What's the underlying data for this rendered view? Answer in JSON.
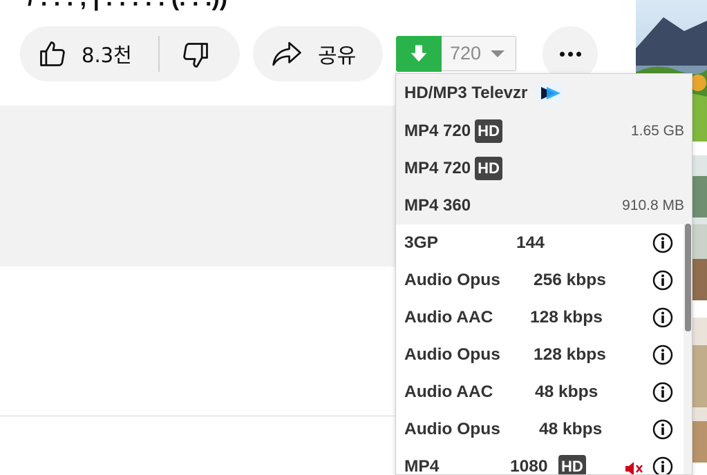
{
  "video": {
    "title_fragment": "/ . . . , | . . . . . (. . .))"
  },
  "actions": {
    "like_count": "8.3천",
    "share_label": "공유",
    "more_label": "..."
  },
  "downloader": {
    "selected_quality": "720",
    "menu": {
      "televzr": "HD/MP3 Televzr",
      "top_rows": [
        {
          "format": "MP4 720",
          "badge": "HD",
          "size": "1.65 GB"
        },
        {
          "format": "MP4 720",
          "badge": "HD",
          "size": ""
        },
        {
          "format": "MP4 360",
          "badge": "",
          "size": "910.8 MB"
        }
      ],
      "rows": [
        {
          "format": "3GP",
          "quality": "144"
        },
        {
          "format": "Audio Opus",
          "quality": "256 kbps"
        },
        {
          "format": "Audio AAC",
          "quality": "128 kbps"
        },
        {
          "format": "Audio Opus",
          "quality": "128 kbps"
        },
        {
          "format": "Audio AAC",
          "quality": "48 kbps"
        },
        {
          "format": "Audio Opus",
          "quality": "48 kbps"
        }
      ],
      "partial_row": {
        "format": "MP4",
        "quality": "1080",
        "badge": "HD"
      }
    }
  },
  "colors": {
    "download_green": "#2bb34b",
    "hd_badge": "#444444",
    "muted_red": "#d0021b"
  }
}
